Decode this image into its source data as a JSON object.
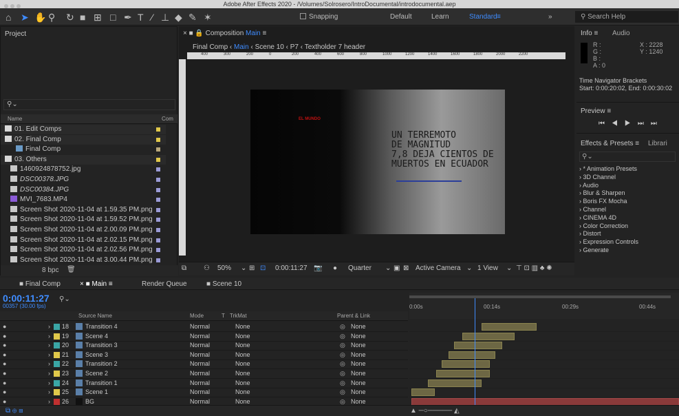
{
  "window": {
    "title": "Adobe After Effects 2020 - /Volumes/Solrosero/IntroDocumental/introdocumental.aep"
  },
  "toolbar": {
    "snapping": "Snapping",
    "workspaces": [
      "Default",
      "Learn",
      "Standard"
    ],
    "active_workspace": "Standard",
    "search_placeholder": "Search Help"
  },
  "project": {
    "title": "Project",
    "col_name": "Name",
    "col_comment": "Com",
    "items": [
      "01. Edit Comps",
      "02. Final Comp",
      "Final Comp",
      "03. Others",
      "1460924878752.jpg",
      "DSC00378.JPG",
      "DSC00384.JPG",
      "MVI_7683.MP4",
      "Screen Shot 2020-11-04 at 1.59.35 PM.png",
      "Screen Shot 2020-11-04 at 1.59.52 PM.png",
      "Screen Shot 2020-11-04 at 2.00.09 PM.png",
      "Screen Shot 2020-11-04 at 2.02.15 PM.png",
      "Screen Shot 2020-11-04 at 2.02.56 PM.png",
      "Screen Shot 2020-11-04 at 3.00.44 PM.png"
    ],
    "bpc": "8 bpc"
  },
  "composition": {
    "tab": "Composition",
    "tab_name": "Main",
    "breadcrumbs": [
      "Final Comp",
      "Main",
      "Scene 10",
      "P7",
      "Textholder 7 header"
    ],
    "ruler": [
      "400",
      "300",
      "200",
      "0",
      "200",
      "400",
      "600",
      "800",
      "1000",
      "1200",
      "1400",
      "1600",
      "1800",
      "2000",
      "2200"
    ],
    "frame_logo": "EL MUNDO",
    "frame_headline": "UN TERREMOTO\nDE MAGNITUD\n7,8 DEJA CIENTOS DE\nMUERTOS EN ECUADOR",
    "zoom": "50%",
    "timecode": "0:00:11:27",
    "resolution": "Quarter",
    "camera": "Active Camera",
    "views": "1 View"
  },
  "info": {
    "tab": "Info",
    "tab2": "Audio",
    "r": "R :",
    "g": "G :",
    "b": "B :",
    "a": "A : 0",
    "x": "X : 2228",
    "y": "Y : 1240",
    "nav": "Time Navigator Brackets",
    "nav_range": "Start: 0:00:20:02, End: 0:00:30:02"
  },
  "preview": {
    "title": "Preview"
  },
  "effects": {
    "tab": "Effects & Presets",
    "tab2": "Librari",
    "items": [
      "* Animation Presets",
      "3D Channel",
      "Audio",
      "Blur & Sharpen",
      "Boris FX Mocha",
      "Channel",
      "CINEMA 4D",
      "Color Correction",
      "Distort",
      "Expression Controls",
      "Generate"
    ]
  },
  "timeline": {
    "tabs": [
      "Final Comp",
      "Main",
      "Render Queue",
      "Scene 10"
    ],
    "timecode": "0:00:11:27",
    "frames": "00357 (30.00 fps)",
    "cols": {
      "source": "Source Name",
      "mode": "Mode",
      "t": "T",
      "trkmat": "TrkMat",
      "parent": "Parent & Link"
    },
    "time_markers": [
      "0:00s",
      "00:14s",
      "00:29s",
      "00:44s"
    ],
    "layers": [
      {
        "num": "18",
        "name": "Transition 4",
        "mode": "Normal",
        "trk": "None",
        "parent": "None",
        "color": "#3aa6a6"
      },
      {
        "num": "19",
        "name": "Scene 4",
        "mode": "Normal",
        "trk": "None",
        "parent": "None",
        "color": "#e0c84a"
      },
      {
        "num": "20",
        "name": "Transition 3",
        "mode": "Normal",
        "trk": "None",
        "parent": "None",
        "color": "#3aa6a6"
      },
      {
        "num": "21",
        "name": "Scene 3",
        "mode": "Normal",
        "trk": "None",
        "parent": "None",
        "color": "#e0c84a"
      },
      {
        "num": "22",
        "name": "Transition 2",
        "mode": "Normal",
        "trk": "None",
        "parent": "None",
        "color": "#3aa6a6"
      },
      {
        "num": "23",
        "name": "Scene 2",
        "mode": "Normal",
        "trk": "None",
        "parent": "None",
        "color": "#e0c84a"
      },
      {
        "num": "24",
        "name": "Transition 1",
        "mode": "Normal",
        "trk": "None",
        "parent": "None",
        "color": "#3aa6a6"
      },
      {
        "num": "25",
        "name": "Scene 1",
        "mode": "Normal",
        "trk": "None",
        "parent": "None",
        "color": "#e0c84a"
      },
      {
        "num": "26",
        "name": "BG",
        "mode": "Normal",
        "trk": "None",
        "parent": "None",
        "color": "#c03030"
      }
    ]
  }
}
